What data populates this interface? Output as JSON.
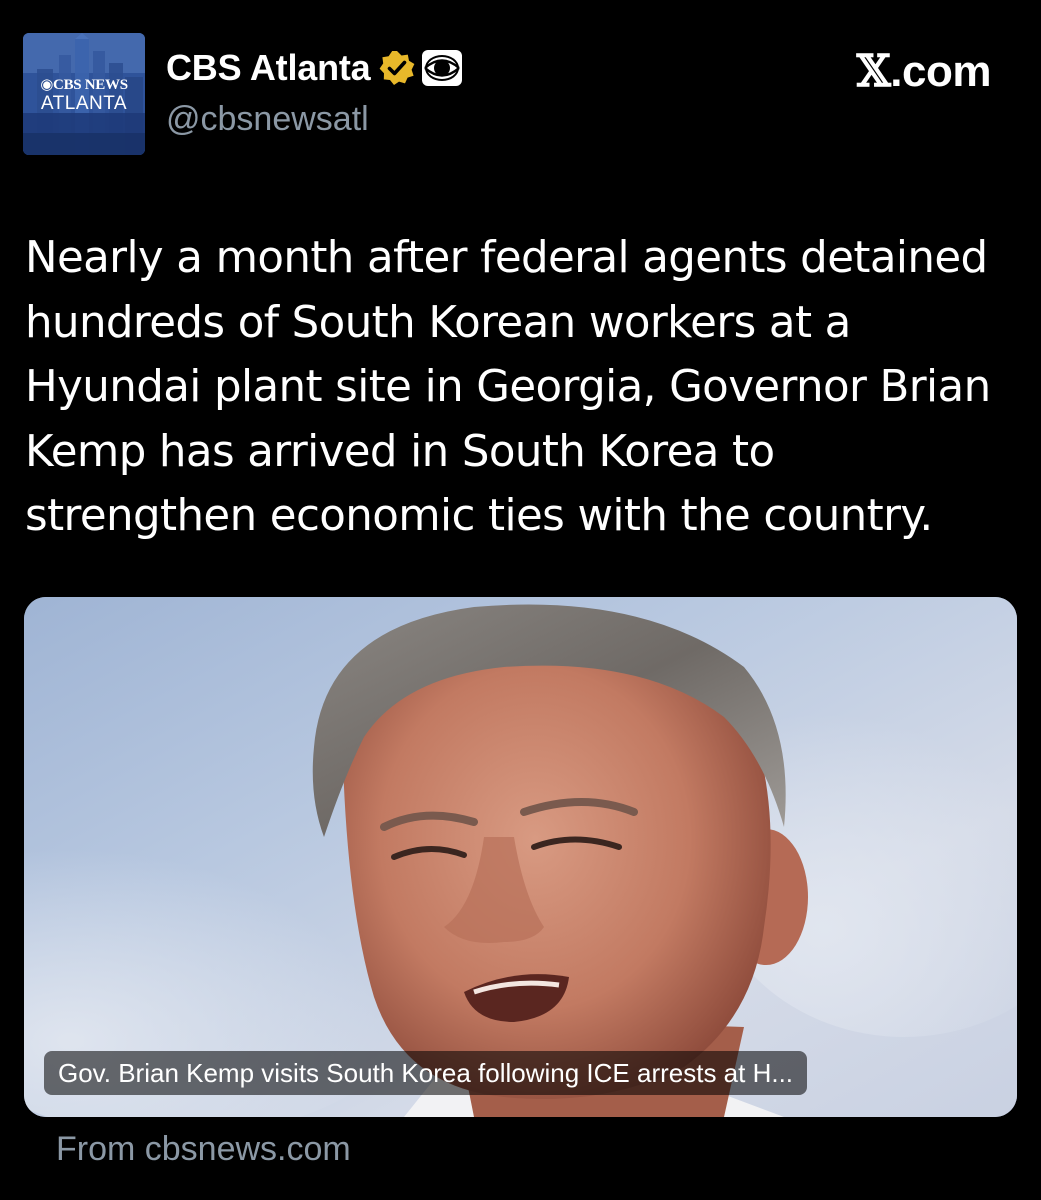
{
  "author": {
    "avatar_brand": "◉CBS NEWS",
    "avatar_city": "ATLANTA",
    "display_name": "CBS Atlanta",
    "handle": "@cbsnewsatl",
    "verified_icon": "verified-badge-icon",
    "affiliate_icon": "cbs-eye-logo-icon",
    "badge_color": "#e8b82a"
  },
  "site": {
    "label": ".com",
    "x_glyph": "𝕏"
  },
  "post": {
    "text": "Nearly a month after federal agents detained hundreds of South Korean workers at a Hyundai plant site in Georgia, Governor Brian Kemp has arrived in South Korea to strengthen economic ties with the country."
  },
  "card": {
    "caption": "Gov. Brian Kemp visits South Korea following ICE arrests at H...",
    "source": "From cbsnews.com"
  }
}
